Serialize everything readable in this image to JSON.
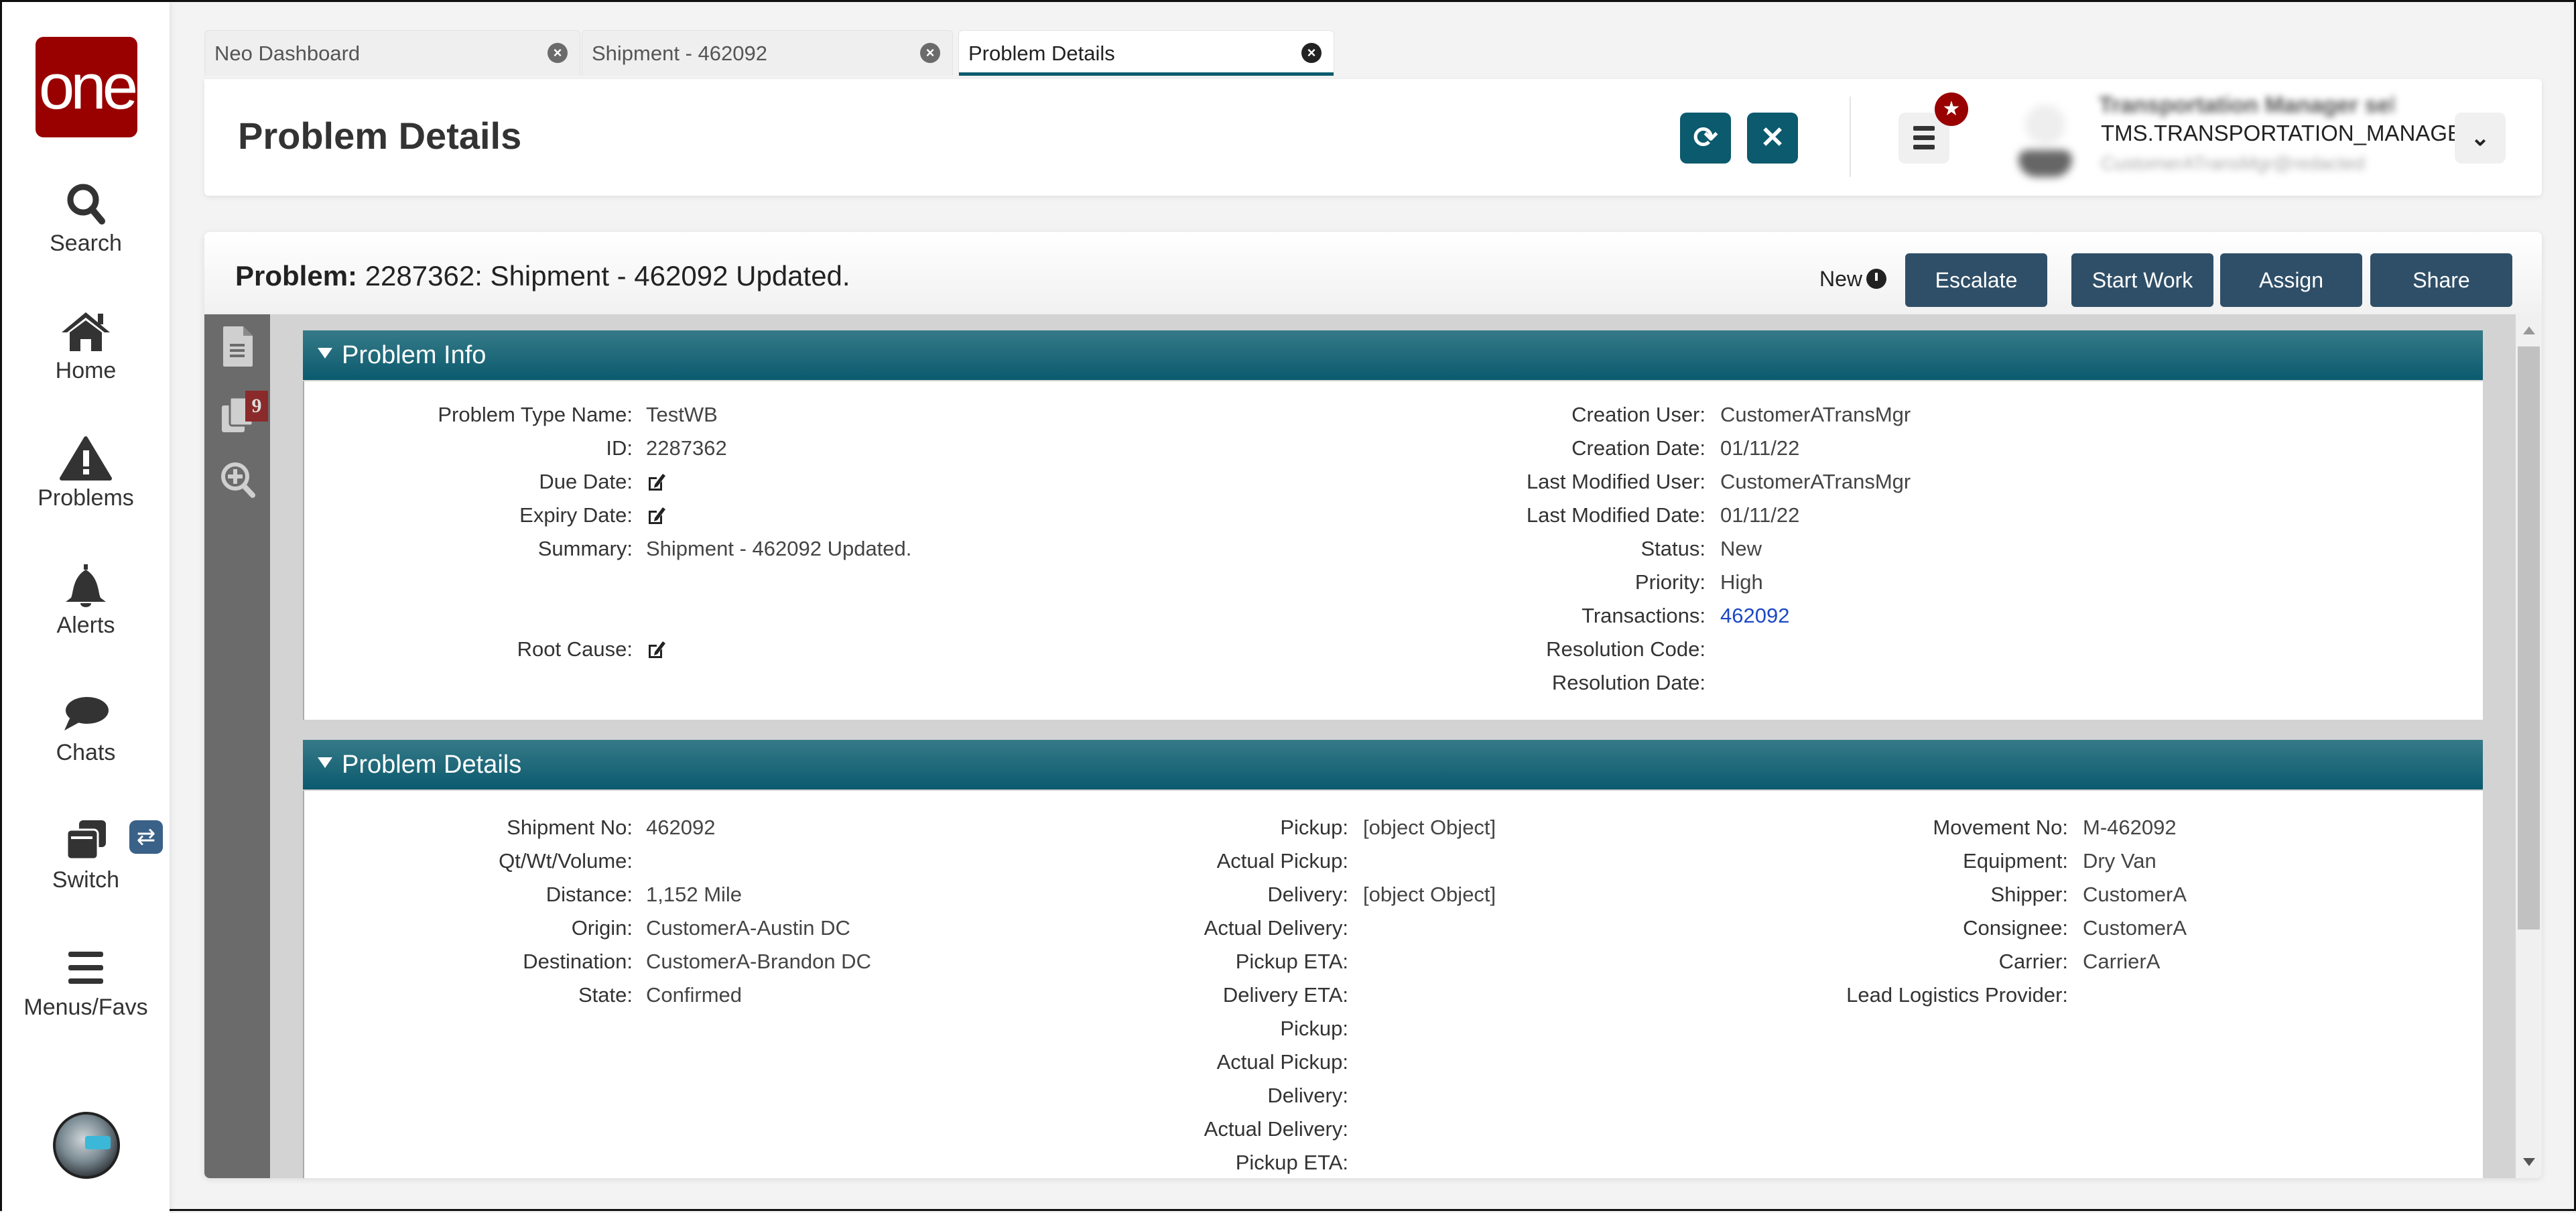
{
  "nav": {
    "logo": "one",
    "items": [
      {
        "label": "Search",
        "icon": "search-icon"
      },
      {
        "label": "Home",
        "icon": "home-icon"
      },
      {
        "label": "Problems",
        "icon": "warning-icon"
      },
      {
        "label": "Alerts",
        "icon": "bell-icon"
      },
      {
        "label": "Chats",
        "icon": "chat-icon"
      },
      {
        "label": "Switch",
        "icon": "switch-icon"
      },
      {
        "label": "Menus/Favs",
        "icon": "menu-icon"
      }
    ],
    "switch_badge": "⇄"
  },
  "tabs": [
    {
      "label": "Neo Dashboard",
      "active": false
    },
    {
      "label": "Shipment - 462092",
      "active": false
    },
    {
      "label": "Problem Details",
      "active": true
    }
  ],
  "header": {
    "title": "Problem Details",
    "refresh_icon": "⟳",
    "close_icon": "✕",
    "star_badge": "★",
    "user_name": "Transportation Manager self",
    "user_role": "TMS.TRANSPORTATION_MANAGER",
    "user_email": "CustomerATransMgr@redacted",
    "user_dropdown": "⌄"
  },
  "problem": {
    "title_label": "Problem:",
    "title_value": "2287362: Shipment - 462092 Updated.",
    "status": "New",
    "actions": [
      "Escalate",
      "Start Work",
      "Assign",
      "Share"
    ],
    "rail_badge": "9"
  },
  "problem_info": {
    "title": "Problem Info",
    "left": [
      {
        "label": "Problem Type Name:",
        "value": "TestWB"
      },
      {
        "label": "ID:",
        "value": "2287362"
      },
      {
        "label": "Due Date:",
        "value": "",
        "editable": true
      },
      {
        "label": "Expiry Date:",
        "value": "",
        "editable": true
      },
      {
        "label": "Summary:",
        "value": "Shipment - 462092 Updated."
      },
      {
        "label": "Root Cause:",
        "value": "",
        "editable": true
      }
    ],
    "right": [
      {
        "label": "Creation User:",
        "value": "CustomerATransMgr"
      },
      {
        "label": "Creation Date:",
        "value": "01/11/22"
      },
      {
        "label": "Last Modified User:",
        "value": "CustomerATransMgr"
      },
      {
        "label": "Last Modified Date:",
        "value": "01/11/22"
      },
      {
        "label": "Status:",
        "value": "New"
      },
      {
        "label": "Priority:",
        "value": "High"
      },
      {
        "label": "Transactions:",
        "value": "462092",
        "link": true
      },
      {
        "label": "Resolution Code:",
        "value": ""
      },
      {
        "label": "Resolution Date:",
        "value": ""
      }
    ]
  },
  "problem_details": {
    "title": "Problem Details",
    "col1": [
      {
        "label": "Shipment No:",
        "value": "462092"
      },
      {
        "label": "Qt/Wt/Volume:",
        "value": ""
      },
      {
        "label": "Distance:",
        "value": "1,152 Mile"
      },
      {
        "label": "Origin:",
        "value": "CustomerA-Austin DC"
      },
      {
        "label": "Destination:",
        "value": "CustomerA-Brandon DC"
      },
      {
        "label": "State:",
        "value": "Confirmed"
      }
    ],
    "col2": [
      {
        "label": "Pickup:",
        "value": "[object Object]"
      },
      {
        "label": "Actual Pickup:",
        "value": ""
      },
      {
        "label": "Delivery:",
        "value": "[object Object]"
      },
      {
        "label": "Actual Delivery:",
        "value": ""
      },
      {
        "label": "Pickup ETA:",
        "value": ""
      },
      {
        "label": "Delivery ETA:",
        "value": ""
      },
      {
        "label": "Pickup:",
        "value": ""
      },
      {
        "label": "Actual Pickup:",
        "value": ""
      },
      {
        "label": "Delivery:",
        "value": ""
      },
      {
        "label": "Actual Delivery:",
        "value": ""
      },
      {
        "label": "Pickup ETA:",
        "value": ""
      }
    ],
    "col3": [
      {
        "label": "Movement No:",
        "value": "M-462092"
      },
      {
        "label": "Equipment:",
        "value": "Dry Van"
      },
      {
        "label": "Shipper:",
        "value": "CustomerA"
      },
      {
        "label": "Consignee:",
        "value": "CustomerA"
      },
      {
        "label": "Carrier:",
        "value": "CarrierA"
      },
      {
        "label": "Lead Logistics Provider:",
        "value": ""
      }
    ]
  }
}
